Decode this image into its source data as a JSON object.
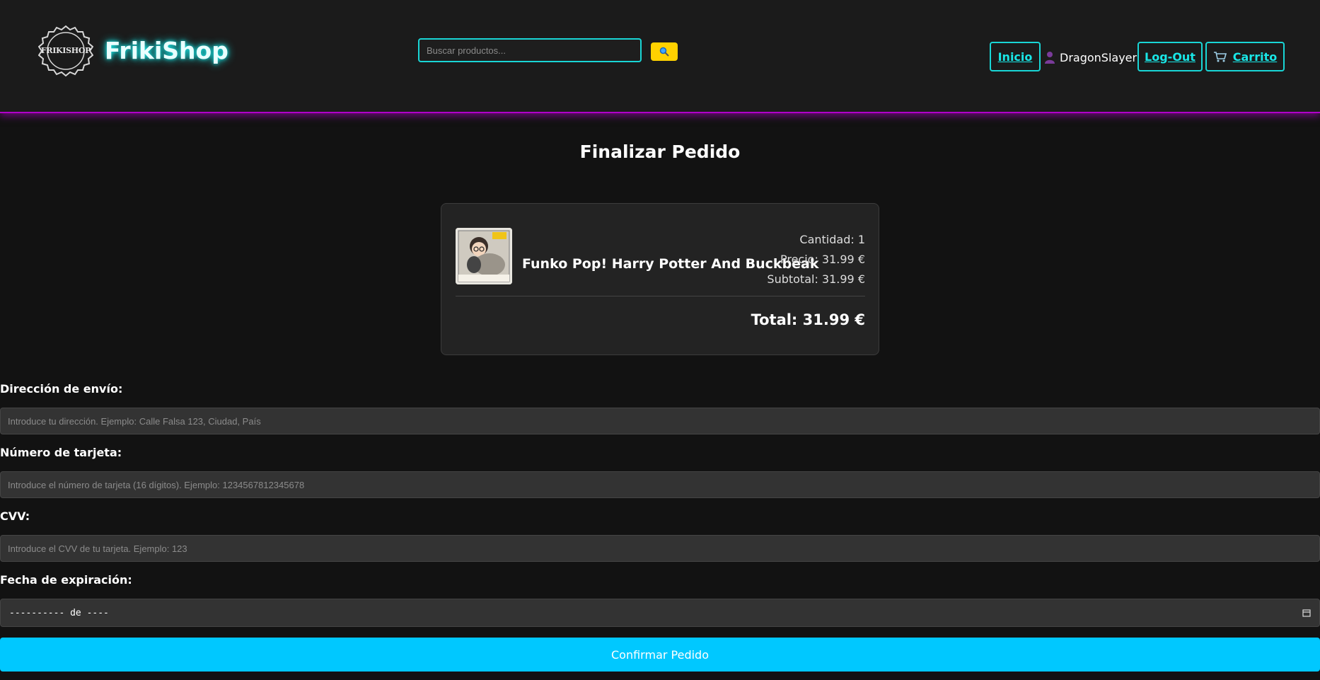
{
  "header": {
    "logo_text": "FRIKISHOP",
    "brand": "FrikiShop",
    "search_placeholder": "Buscar productos...",
    "search_icon": "magnifier-icon",
    "nav": {
      "home": "Inicio",
      "user_icon": "user-icon",
      "username": "DragonSlayer",
      "logout": "Log-Out",
      "cart_icon": "cart-icon",
      "cart": "Carrito"
    }
  },
  "page": {
    "title": "Finalizar Pedido"
  },
  "order": {
    "items": [
      {
        "name": "Funko Pop! Harry Potter And Buckbeak",
        "quantity": "Cantidad: 1",
        "price": "Precio: 31.99 €",
        "subtotal": "Subtotal: 31.99 €"
      }
    ],
    "total": "Total: 31.99 €"
  },
  "form": {
    "address_label": "Dirección de envío:",
    "address_placeholder": "Introduce tu dirección. Ejemplo: Calle Falsa 123, Ciudad, País",
    "card_label": "Número de tarjeta:",
    "card_placeholder": "Introduce el número de tarjeta (16 dígitos). Ejemplo: 1234567812345678",
    "cvv_label": "CVV:",
    "cvv_placeholder": "Introduce el CVV de tu tarjeta. Ejemplo: 123",
    "expiry_label": "Fecha de expiración:",
    "expiry_value": "---------- de ----",
    "confirm": "Confirmar Pedido"
  },
  "colors": {
    "accent_cyan": "#19d6d6",
    "accent_magenta": "#b100c9",
    "search_button": "#ffd200",
    "confirm_button": "#00c8ff"
  }
}
